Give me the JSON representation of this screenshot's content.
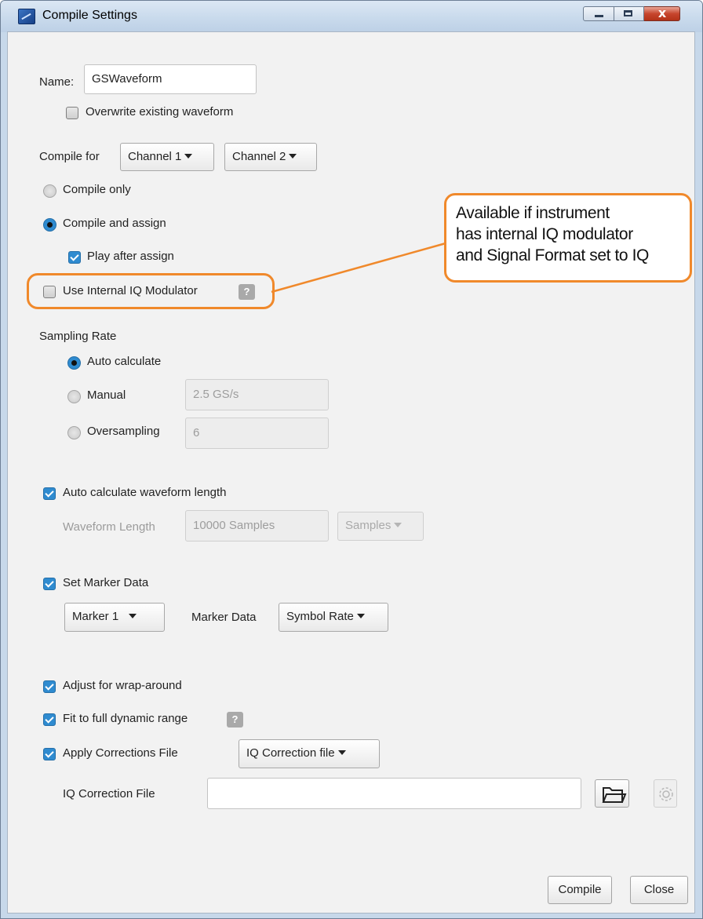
{
  "window": {
    "title": "Compile Settings",
    "close_glyph": "x"
  },
  "name_field": {
    "label": "Name:",
    "value": "GSWaveform"
  },
  "overwrite": {
    "label": "Overwrite existing waveform",
    "checked": false
  },
  "compile_for": {
    "label": "Compile for",
    "channel1": "Channel 1",
    "channel2": "Channel 2"
  },
  "mode": {
    "compile_only": "Compile only",
    "compile_and_assign": "Compile and assign",
    "selected": "compile_and_assign"
  },
  "play_after_assign": {
    "label": "Play after assign",
    "checked": true
  },
  "use_internal_iq": {
    "label": "Use Internal IQ Modulator",
    "checked": false
  },
  "help_glyph": "?",
  "callout": {
    "line1": "Available if instrument",
    "line2": "has internal IQ modulator",
    "line3": "and Signal Format set to IQ",
    "color": "#f0892b"
  },
  "sampling_rate": {
    "heading": "Sampling Rate",
    "auto": "Auto calculate",
    "manual": "Manual",
    "manual_value": "2.5 GS/s",
    "oversampling": "Oversampling",
    "oversampling_value": "6",
    "selected": "auto"
  },
  "waveform_length": {
    "auto_label": "Auto calculate waveform length",
    "auto_checked": true,
    "length_label": "Waveform Length",
    "length_value": "10000 Samples",
    "unit": "Samples"
  },
  "marker": {
    "set_label": "Set Marker Data",
    "set_checked": true,
    "marker_select": "Marker 1",
    "data_label": "Marker Data",
    "data_select": "Symbol Rate"
  },
  "options": {
    "wrap_around": "Adjust for wrap-around",
    "fit_dynamic": "Fit to full dynamic range",
    "apply_corrections": "Apply Corrections File",
    "correction_type": "IQ Correction file"
  },
  "iq_correction": {
    "label": "IQ Correction File",
    "value": ""
  },
  "buttons": {
    "compile": "Compile",
    "close": "Close"
  },
  "colors": {
    "accent": "#2f8bd0",
    "highlight": "#f0892b"
  }
}
